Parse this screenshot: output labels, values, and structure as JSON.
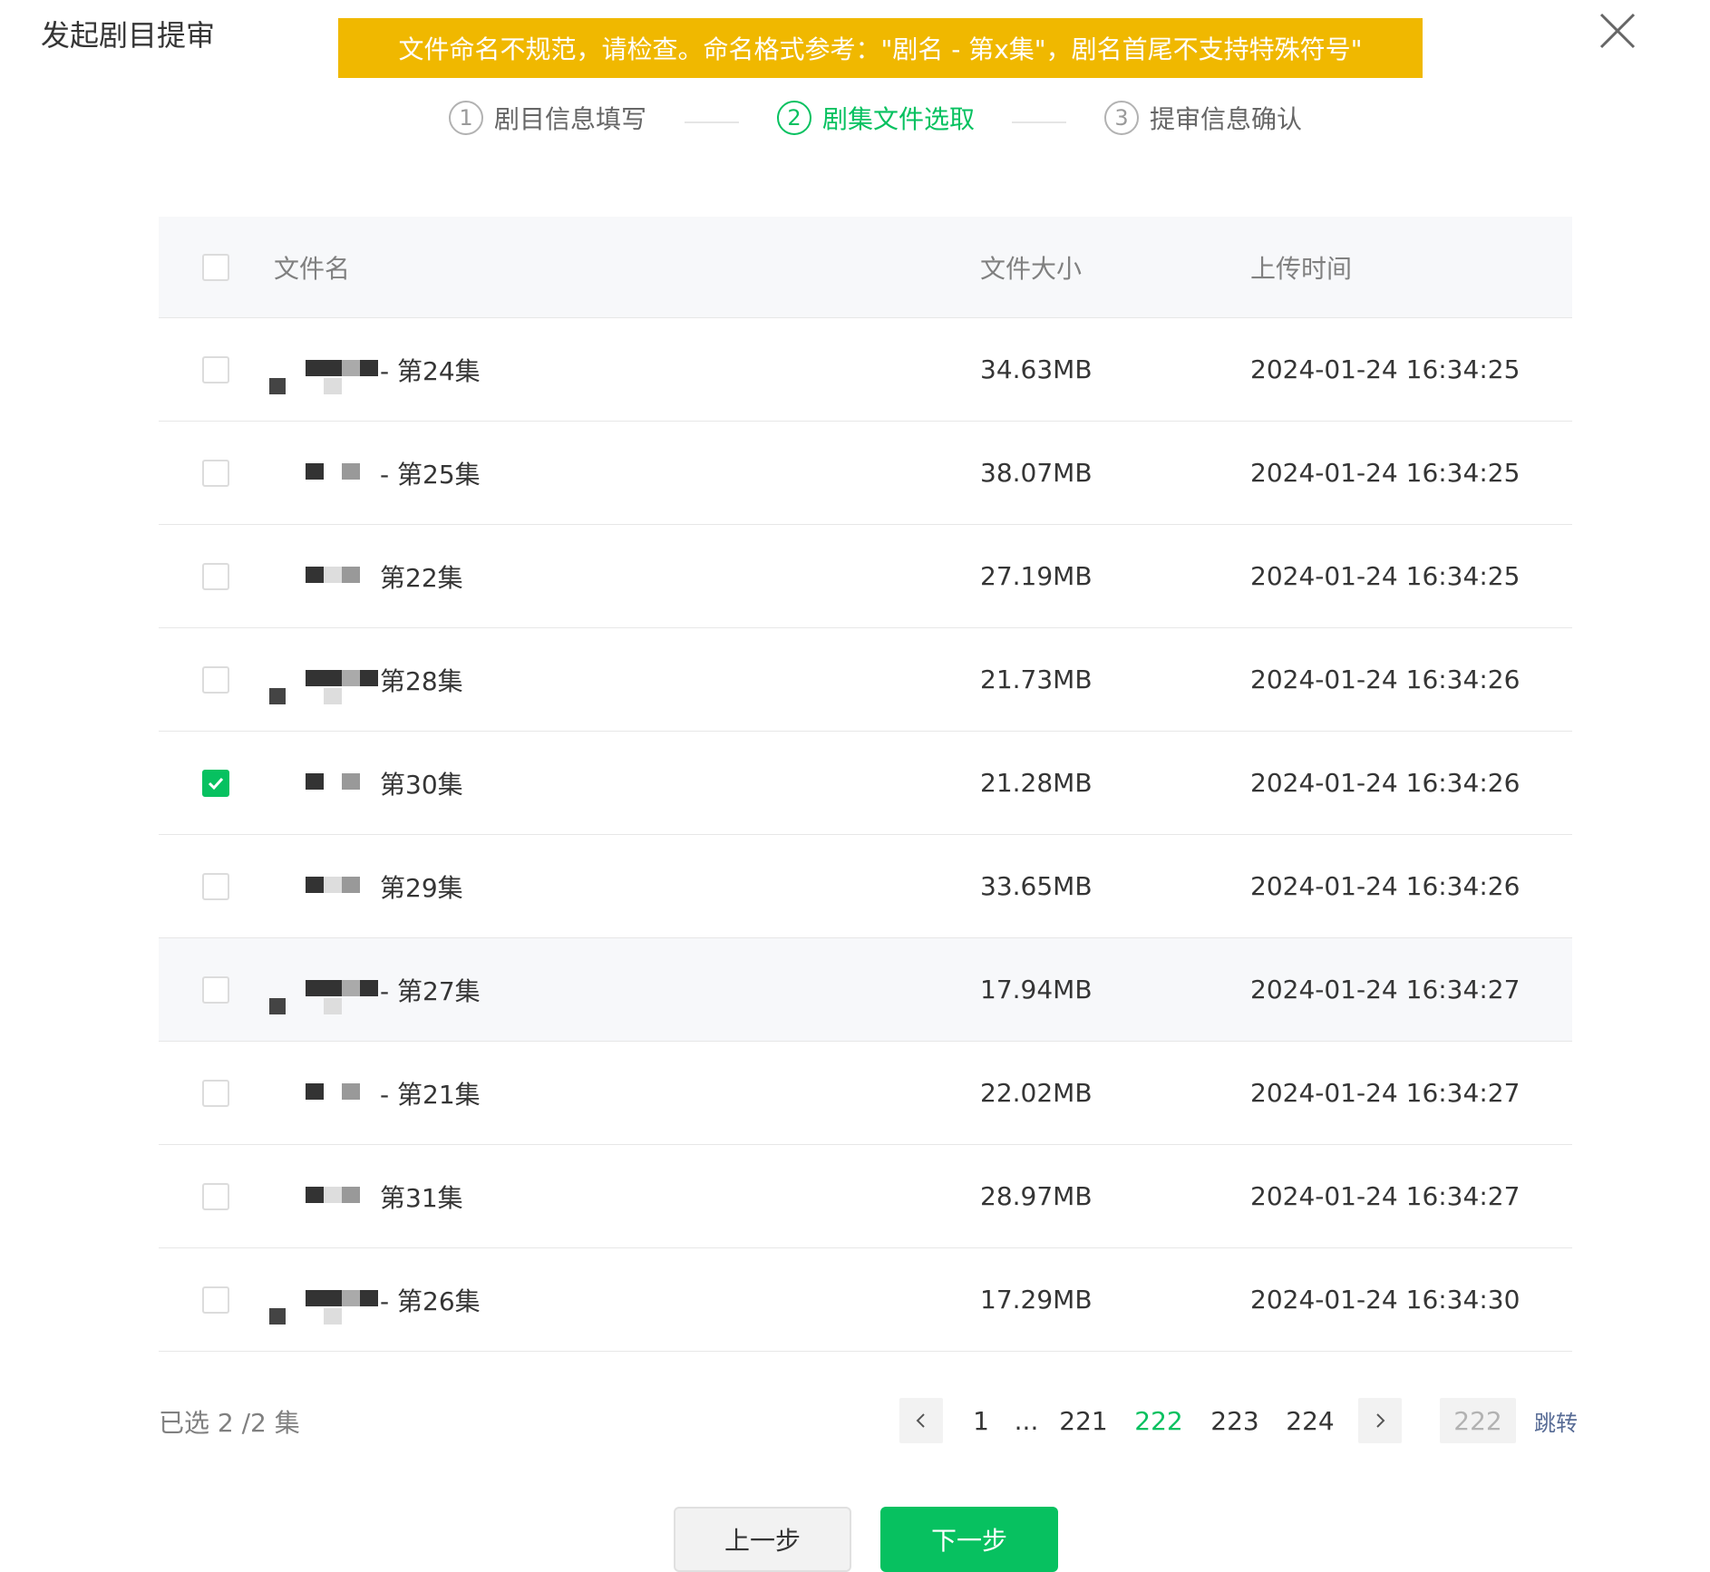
{
  "dialog": {
    "title": "发起剧目提审",
    "close_icon": "close-icon"
  },
  "banner": {
    "text": "文件命名不规范，请检查。命名格式参考：\"剧名 - 第x集\"，剧名首尾不支持特殊符号\"",
    "bg": "#F0B800"
  },
  "steps": [
    {
      "num": "1",
      "label": "剧目信息填写",
      "state": "done"
    },
    {
      "num": "2",
      "label": "剧集文件选取",
      "state": "active"
    },
    {
      "num": "3",
      "label": "提审信息确认",
      "state": "todo"
    }
  ],
  "table": {
    "headers": {
      "name": "文件名",
      "size": "文件大小",
      "time": "上传时间"
    },
    "rows": [
      {
        "episode": "- 第24集",
        "size": "34.63MB",
        "time": "2024-01-24 16:34:25",
        "checked": false
      },
      {
        "episode": "- 第25集",
        "size": "38.07MB",
        "time": "2024-01-24 16:34:25",
        "checked": false
      },
      {
        "episode": "第22集",
        "size": "27.19MB",
        "time": "2024-01-24 16:34:25",
        "checked": false
      },
      {
        "episode": "第28集",
        "size": "21.73MB",
        "time": "2024-01-24 16:34:26",
        "checked": false
      },
      {
        "episode": "第30集",
        "size": "21.28MB",
        "time": "2024-01-24 16:34:26",
        "checked": true
      },
      {
        "episode": "第29集",
        "size": "33.65MB",
        "time": "2024-01-24 16:34:26",
        "checked": false
      },
      {
        "episode": "- 第27集",
        "size": "17.94MB",
        "time": "2024-01-24 16:34:27",
        "checked": false
      },
      {
        "episode": "- 第21集",
        "size": "22.02MB",
        "time": "2024-01-24 16:34:27",
        "checked": false
      },
      {
        "episode": "第31集",
        "size": "28.97MB",
        "time": "2024-01-24 16:34:27",
        "checked": false
      },
      {
        "episode": "- 第26集",
        "size": "17.29MB",
        "time": "2024-01-24 16:34:30",
        "checked": false
      }
    ]
  },
  "footer": {
    "selected_text": "已选 2 /2 集"
  },
  "pagination": {
    "pages": [
      "1",
      "...",
      "221",
      "222",
      "223",
      "224"
    ],
    "current": "222",
    "input_value": "222",
    "jump_label": "跳转"
  },
  "buttons": {
    "prev": "上一步",
    "next": "下一步"
  },
  "colors": {
    "accent": "#07C160",
    "link": "#576B95"
  }
}
